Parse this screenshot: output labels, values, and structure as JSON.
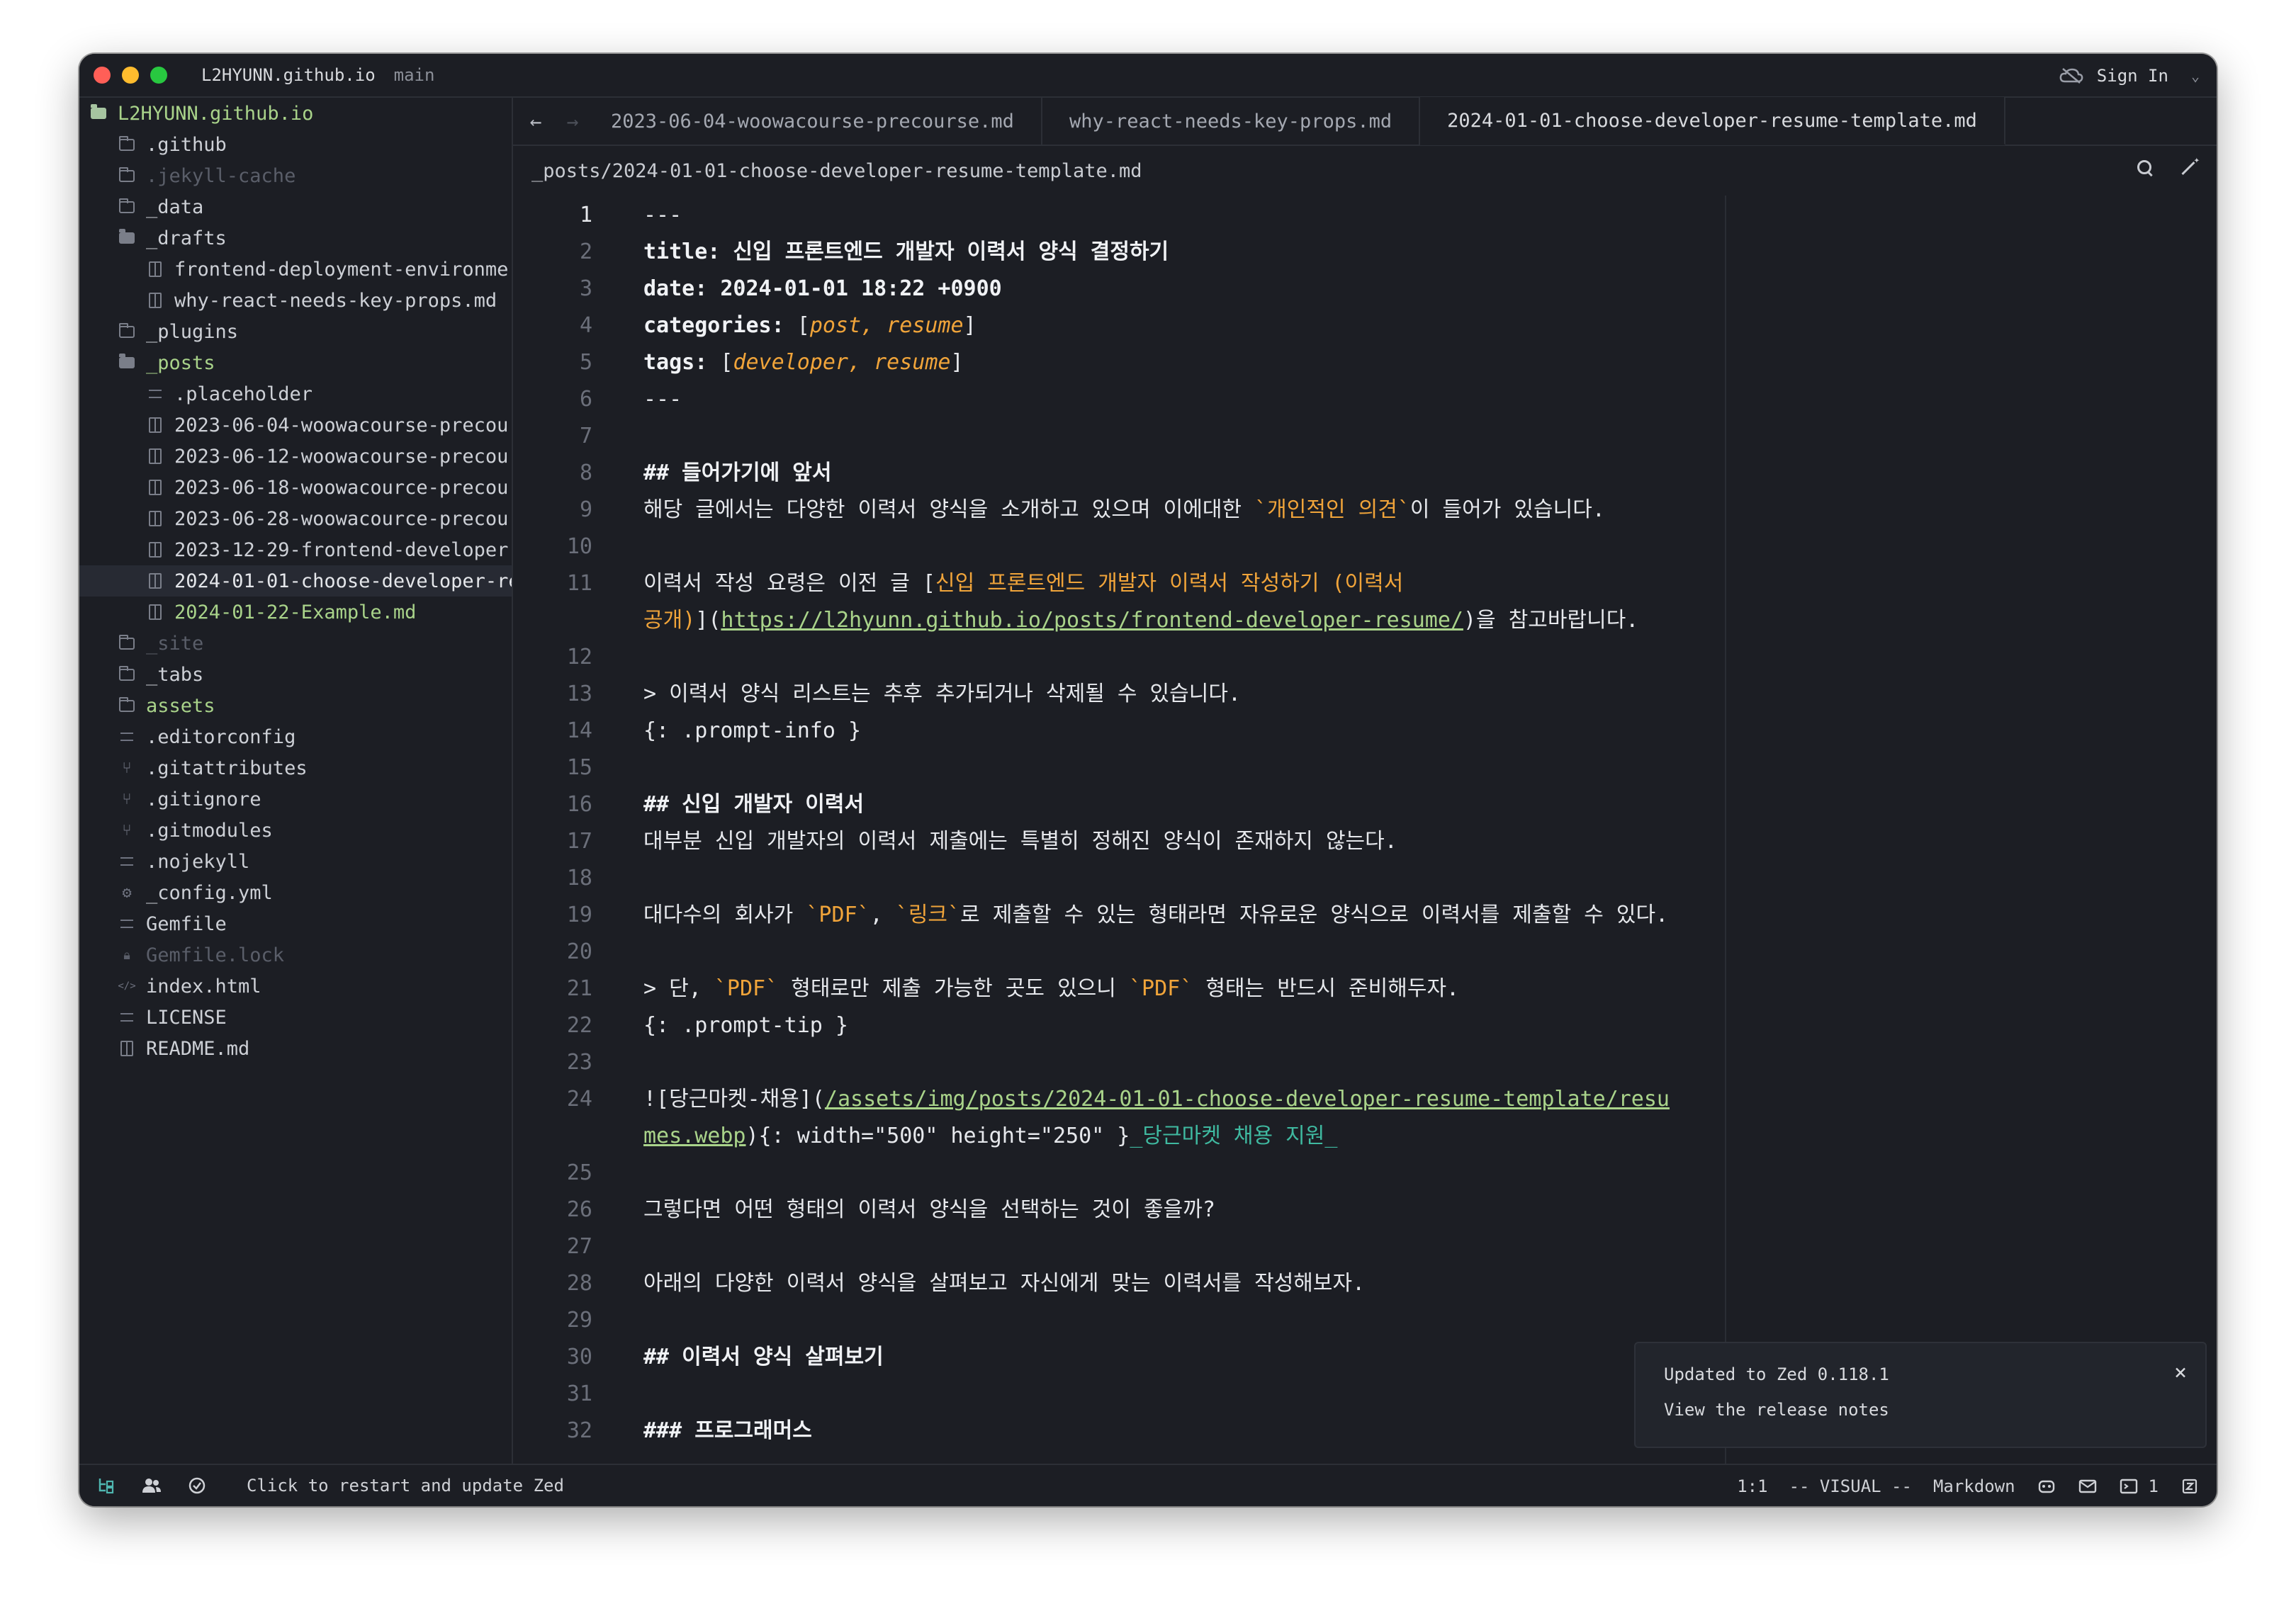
{
  "titlebar": {
    "project": "L2HYUNN.github.io",
    "branch": "main",
    "sign_in": "Sign In",
    "chevron": "⌄"
  },
  "sidebar": {
    "items": [
      {
        "label": "L2HYUNN.github.io",
        "indent": 0,
        "icon": "folder-open-icon",
        "style": "root"
      },
      {
        "label": ".github",
        "indent": 1,
        "icon": "folder-icon",
        "style": "normal"
      },
      {
        "label": ".jekyll-cache",
        "indent": 1,
        "icon": "folder-icon",
        "style": "dim"
      },
      {
        "label": "_data",
        "indent": 1,
        "icon": "folder-icon",
        "style": "normal"
      },
      {
        "label": "_drafts",
        "indent": 1,
        "icon": "folder-open-icon",
        "style": "normal"
      },
      {
        "label": "frontend-deployment-environme",
        "indent": 2,
        "icon": "markdown-file-icon",
        "style": "normal"
      },
      {
        "label": "why-react-needs-key-props.md",
        "indent": 2,
        "icon": "markdown-file-icon",
        "style": "normal"
      },
      {
        "label": "_plugins",
        "indent": 1,
        "icon": "folder-icon",
        "style": "normal"
      },
      {
        "label": "_posts",
        "indent": 1,
        "icon": "folder-open-icon",
        "style": "green"
      },
      {
        "label": ".placeholder",
        "indent": 2,
        "icon": "text-file-icon",
        "style": "normal"
      },
      {
        "label": "2023-06-04-woowacourse-precou",
        "indent": 2,
        "icon": "markdown-file-icon",
        "style": "normal"
      },
      {
        "label": "2023-06-12-woowacourse-precou",
        "indent": 2,
        "icon": "markdown-file-icon",
        "style": "normal"
      },
      {
        "label": "2023-06-18-woowacource-precou",
        "indent": 2,
        "icon": "markdown-file-icon",
        "style": "normal"
      },
      {
        "label": "2023-06-28-woowacource-precou",
        "indent": 2,
        "icon": "markdown-file-icon",
        "style": "normal"
      },
      {
        "label": "2023-12-29-frontend-developer-",
        "indent": 2,
        "icon": "markdown-file-icon",
        "style": "normal"
      },
      {
        "label": "2024-01-01-choose-developer-re",
        "indent": 2,
        "icon": "markdown-file-icon",
        "style": "selected"
      },
      {
        "label": "2024-01-22-Example.md",
        "indent": 2,
        "icon": "markdown-file-icon",
        "style": "green"
      },
      {
        "label": "_site",
        "indent": 1,
        "icon": "folder-icon",
        "style": "dim"
      },
      {
        "label": "_tabs",
        "indent": 1,
        "icon": "folder-icon",
        "style": "normal"
      },
      {
        "label": "assets",
        "indent": 1,
        "icon": "folder-icon",
        "style": "green"
      },
      {
        "label": ".editorconfig",
        "indent": 1,
        "icon": "text-file-icon",
        "style": "normal"
      },
      {
        "label": ".gitattributes",
        "indent": 1,
        "icon": "git-icon",
        "style": "normal"
      },
      {
        "label": ".gitignore",
        "indent": 1,
        "icon": "git-icon",
        "style": "normal"
      },
      {
        "label": ".gitmodules",
        "indent": 1,
        "icon": "git-icon",
        "style": "normal"
      },
      {
        "label": ".nojekyll",
        "indent": 1,
        "icon": "text-file-icon",
        "style": "normal"
      },
      {
        "label": "_config.yml",
        "indent": 1,
        "icon": "gear-icon",
        "style": "normal"
      },
      {
        "label": "Gemfile",
        "indent": 1,
        "icon": "text-file-icon",
        "style": "normal"
      },
      {
        "label": "Gemfile.lock",
        "indent": 1,
        "icon": "lock-icon",
        "style": "dim"
      },
      {
        "label": "index.html",
        "indent": 1,
        "icon": "code-icon",
        "style": "normal"
      },
      {
        "label": "LICENSE",
        "indent": 1,
        "icon": "text-file-icon",
        "style": "normal"
      },
      {
        "label": "README.md",
        "indent": 1,
        "icon": "markdown-file-icon",
        "style": "normal"
      }
    ]
  },
  "tabs": [
    {
      "label": "2023-06-04-woowacourse-precourse.md",
      "active": false
    },
    {
      "label": "why-react-needs-key-props.md",
      "active": false
    },
    {
      "label": "2024-01-01-choose-developer-resume-template.md",
      "active": true
    }
  ],
  "breadcrumb": "_posts/2024-01-01-choose-developer-resume-template.md",
  "editor": {
    "lines": [
      {
        "n": "1",
        "cur": true,
        "segs": [
          [
            "w",
            "---"
          ]
        ]
      },
      {
        "n": "2",
        "segs": [
          [
            "b",
            "title: 신입 프론트엔드 개발자 이력서 양식 결정하기"
          ]
        ]
      },
      {
        "n": "3",
        "segs": [
          [
            "b",
            "date: 2024-01-01 18:22 +0900"
          ]
        ]
      },
      {
        "n": "4",
        "segs": [
          [
            "b",
            "categories: "
          ],
          [
            "w",
            "["
          ],
          [
            "oi",
            "post, resume"
          ],
          [
            "w",
            "]"
          ]
        ]
      },
      {
        "n": "5",
        "segs": [
          [
            "b",
            "tags: "
          ],
          [
            "w",
            "["
          ],
          [
            "oi",
            "developer, resume"
          ],
          [
            "w",
            "]"
          ]
        ]
      },
      {
        "n": "6",
        "segs": [
          [
            "w",
            "---"
          ]
        ]
      },
      {
        "n": "7",
        "segs": []
      },
      {
        "n": "8",
        "segs": [
          [
            "b",
            "## 들어가기에 앞서"
          ]
        ]
      },
      {
        "n": "9",
        "segs": [
          [
            "w",
            "해당 글에서는 다양한 이력서 양식을 소개하고 있으며 이에대한 "
          ],
          [
            "o",
            "`개인적인 의견`"
          ],
          [
            "w",
            "이 들어가 있습니다."
          ]
        ]
      },
      {
        "n": "10",
        "segs": []
      },
      {
        "n": "11",
        "segs": [
          [
            "w",
            "이력서 작성 요령은 이전 글 ["
          ],
          [
            "o",
            "신입 프론트엔드 개발자 이력서 작성하기 (이력서"
          ]
        ]
      },
      {
        "n": "",
        "segs": [
          [
            "o",
            "공개)"
          ],
          [
            "w",
            "]("
          ],
          [
            "u",
            "https://l2hyunn.github.io/posts/frontend-developer-resume/"
          ],
          [
            "w",
            ")을 참고바랍니다."
          ]
        ]
      },
      {
        "n": "12",
        "segs": []
      },
      {
        "n": "13",
        "segs": [
          [
            "w",
            "> 이력서 양식 리스트는 추후 추가되거나 삭제될 수 있습니다."
          ]
        ]
      },
      {
        "n": "14",
        "segs": [
          [
            "w",
            "{: .prompt-info }"
          ]
        ]
      },
      {
        "n": "15",
        "segs": []
      },
      {
        "n": "16",
        "segs": [
          [
            "b",
            "## 신입 개발자 이력서"
          ]
        ]
      },
      {
        "n": "17",
        "segs": [
          [
            "w",
            "대부분 신입 개발자의 이력서 제출에는 특별히 정해진 양식이 존재하지 않는다."
          ]
        ]
      },
      {
        "n": "18",
        "segs": []
      },
      {
        "n": "19",
        "segs": [
          [
            "w",
            "대다수의 회사가 "
          ],
          [
            "o",
            "`PDF`"
          ],
          [
            "w",
            ", "
          ],
          [
            "o",
            "`링크`"
          ],
          [
            "w",
            "로 제출할 수 있는 형태라면 자유로운 양식으로 이력서를 제출할 수 있다."
          ]
        ]
      },
      {
        "n": "20",
        "segs": []
      },
      {
        "n": "21",
        "segs": [
          [
            "w",
            "> 단, "
          ],
          [
            "o",
            "`PDF`"
          ],
          [
            "w",
            " 형태로만 제출 가능한 곳도 있으니 "
          ],
          [
            "o",
            "`PDF`"
          ],
          [
            "w",
            " 형태는 반드시 준비해두자."
          ]
        ]
      },
      {
        "n": "22",
        "segs": [
          [
            "w",
            "{: .prompt-tip }"
          ]
        ]
      },
      {
        "n": "23",
        "segs": []
      },
      {
        "n": "24",
        "segs": [
          [
            "w",
            "![당근마켓-채용]("
          ],
          [
            "u",
            "/assets/img/posts/2024-01-01-choose-developer-resume-template/resu"
          ]
        ]
      },
      {
        "n": "",
        "segs": [
          [
            "u",
            "mes.webp"
          ],
          [
            "w",
            "){: width=\"500\" height=\"250\" }"
          ],
          [
            "g",
            "_당근마켓 채용 지원_"
          ]
        ]
      },
      {
        "n": "25",
        "segs": []
      },
      {
        "n": "26",
        "segs": [
          [
            "w",
            "그렇다면 어떤 형태의 이력서 양식을 선택하는 것이 좋을까?"
          ]
        ]
      },
      {
        "n": "27",
        "segs": []
      },
      {
        "n": "28",
        "segs": [
          [
            "w",
            "아래의 다양한 이력서 양식을 살펴보고 자신에게 맞는 이력서를 작성해보자."
          ]
        ]
      },
      {
        "n": "29",
        "segs": []
      },
      {
        "n": "30",
        "segs": [
          [
            "b",
            "## 이력서 양식 살펴보기"
          ]
        ]
      },
      {
        "n": "31",
        "segs": []
      },
      {
        "n": "32",
        "segs": [
          [
            "b",
            "### 프로그래머스"
          ]
        ]
      }
    ]
  },
  "notification": {
    "title": "Updated to Zed 0.118.1",
    "link": "View the release notes",
    "close": "×"
  },
  "statusbar": {
    "message": "Click to restart and update Zed",
    "cursor": "1:1",
    "mode": "-- VISUAL --",
    "language": "Markdown",
    "terminal_count": "1"
  }
}
